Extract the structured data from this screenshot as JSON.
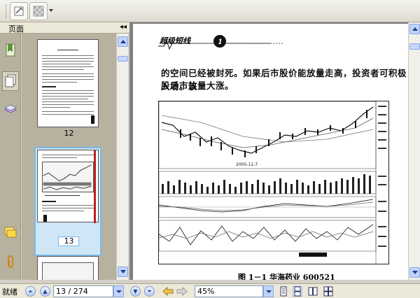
{
  "panel": {
    "title": "页面",
    "collapse_glyph": "◂◂"
  },
  "thumbnails": [
    {
      "page": "12"
    },
    {
      "page": "13"
    }
  ],
  "document": {
    "header_badge": "超级短线",
    "paragraph_lines": [
      "的空间已经被封死。如果后市股价能放量走高，投资者可积极入场。该",
      "股后市放量大涨。"
    ],
    "chart_annotation": "2005-11-7",
    "caption": "图 1－1   华海药业   600521"
  },
  "statusbar": {
    "status": "就绪",
    "page_field": "13 / 274",
    "zoom_field": "45%"
  },
  "icons": {
    "toolbar": [
      "snapshot-icon",
      "background-pattern-icon"
    ],
    "nav": [
      "bookmarks-icon",
      "pages-icon",
      "layers-icon",
      "comments-icon",
      "attachments-icon"
    ]
  }
}
